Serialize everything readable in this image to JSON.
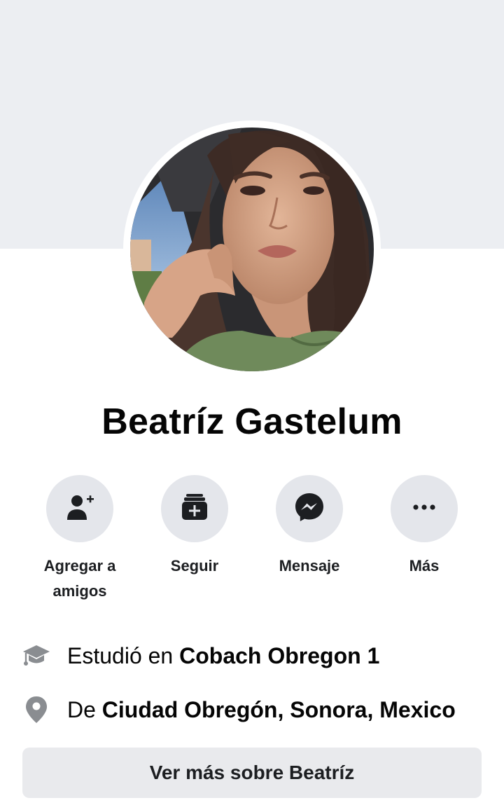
{
  "profile": {
    "name": "Beatríz Gastelum"
  },
  "actions": [
    {
      "label": "Agregar a amigos",
      "icon": "add-friend-icon"
    },
    {
      "label": "Seguir",
      "icon": "follow-icon"
    },
    {
      "label": "Mensaje",
      "icon": "messenger-icon"
    },
    {
      "label": "Más",
      "icon": "more-icon"
    }
  ],
  "info": {
    "education": {
      "prefix": "Estudió en ",
      "value": "Cobach Obregon 1",
      "icon": "graduation-cap-icon"
    },
    "hometown": {
      "prefix": "De ",
      "value": "Ciudad Obregón, Sonora, Mexico",
      "icon": "location-pin-icon"
    }
  },
  "see_more_label": "Ver más sobre Beatríz",
  "colors": {
    "cover": "#eceef2",
    "button_bg": "#e4e6eb",
    "icon_dark": "#1c1e21",
    "icon_gray": "#8a8d91"
  }
}
